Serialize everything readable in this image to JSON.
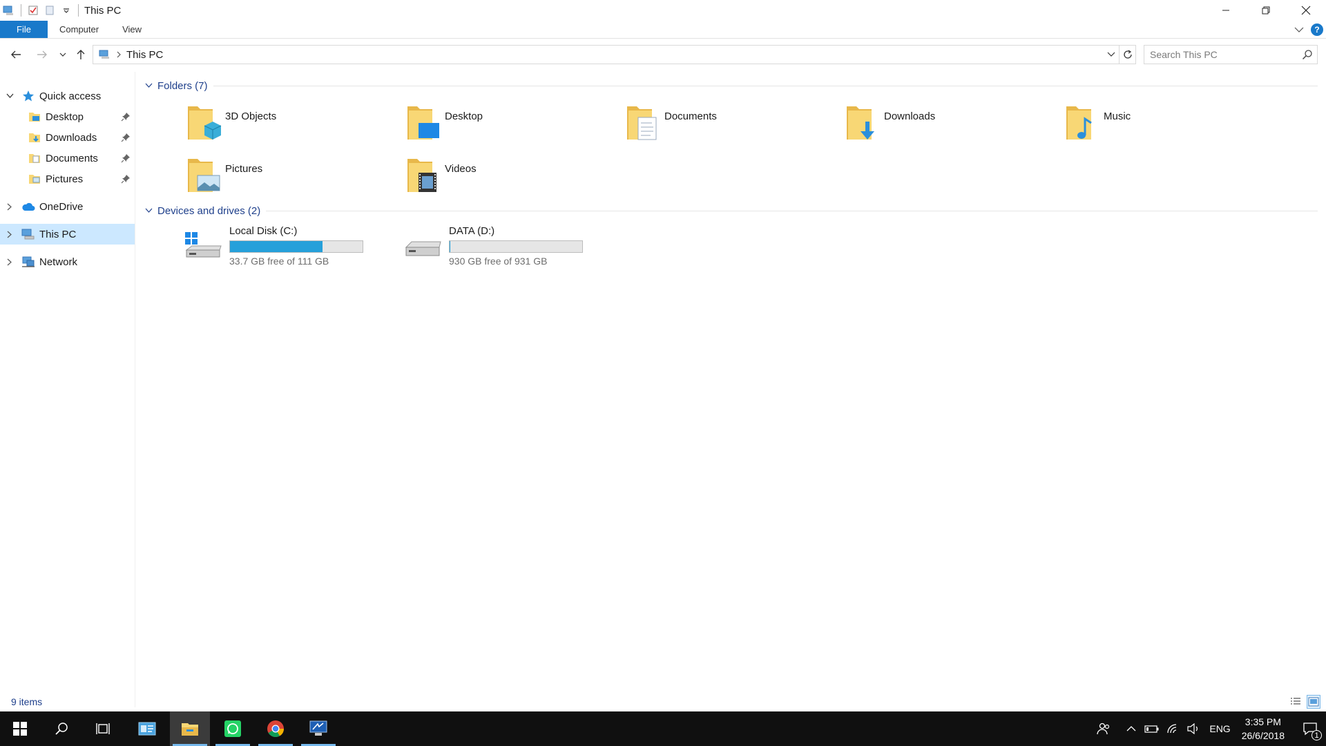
{
  "window": {
    "title": "This PC"
  },
  "ribbon": {
    "tabs": [
      "File",
      "Computer",
      "View"
    ],
    "help_label": "?"
  },
  "address": {
    "path": "This PC",
    "search_placeholder": "Search This PC"
  },
  "nav": {
    "quick_access": "Quick access",
    "quick_items": [
      "Desktop",
      "Downloads",
      "Documents",
      "Pictures"
    ],
    "onedrive": "OneDrive",
    "this_pc": "This PC",
    "network": "Network"
  },
  "folders": {
    "header": "Folders (7)",
    "items": [
      "3D Objects",
      "Desktop",
      "Documents",
      "Downloads",
      "Music",
      "Pictures",
      "Videos"
    ]
  },
  "drives": {
    "header": "Devices and drives (2)",
    "items": [
      {
        "name": "Local Disk (C:)",
        "free": "33.7 GB free of 111 GB",
        "used_fraction": 0.696
      },
      {
        "name": "DATA (D:)",
        "free": "930 GB free of 931 GB",
        "used_fraction": 0.001
      }
    ]
  },
  "status": {
    "count": "9 items"
  },
  "taskbar": {
    "language": "ENG",
    "time": "3:35 PM",
    "date": "26/6/2018",
    "notification_count": "1"
  },
  "colors": {
    "accent": "#1979ca",
    "drive_fill": "#26a0da",
    "selection": "#cce8ff",
    "group_header": "#1e3f8b",
    "folder_yellow": "#f8d775",
    "taskbar": "#101010"
  }
}
